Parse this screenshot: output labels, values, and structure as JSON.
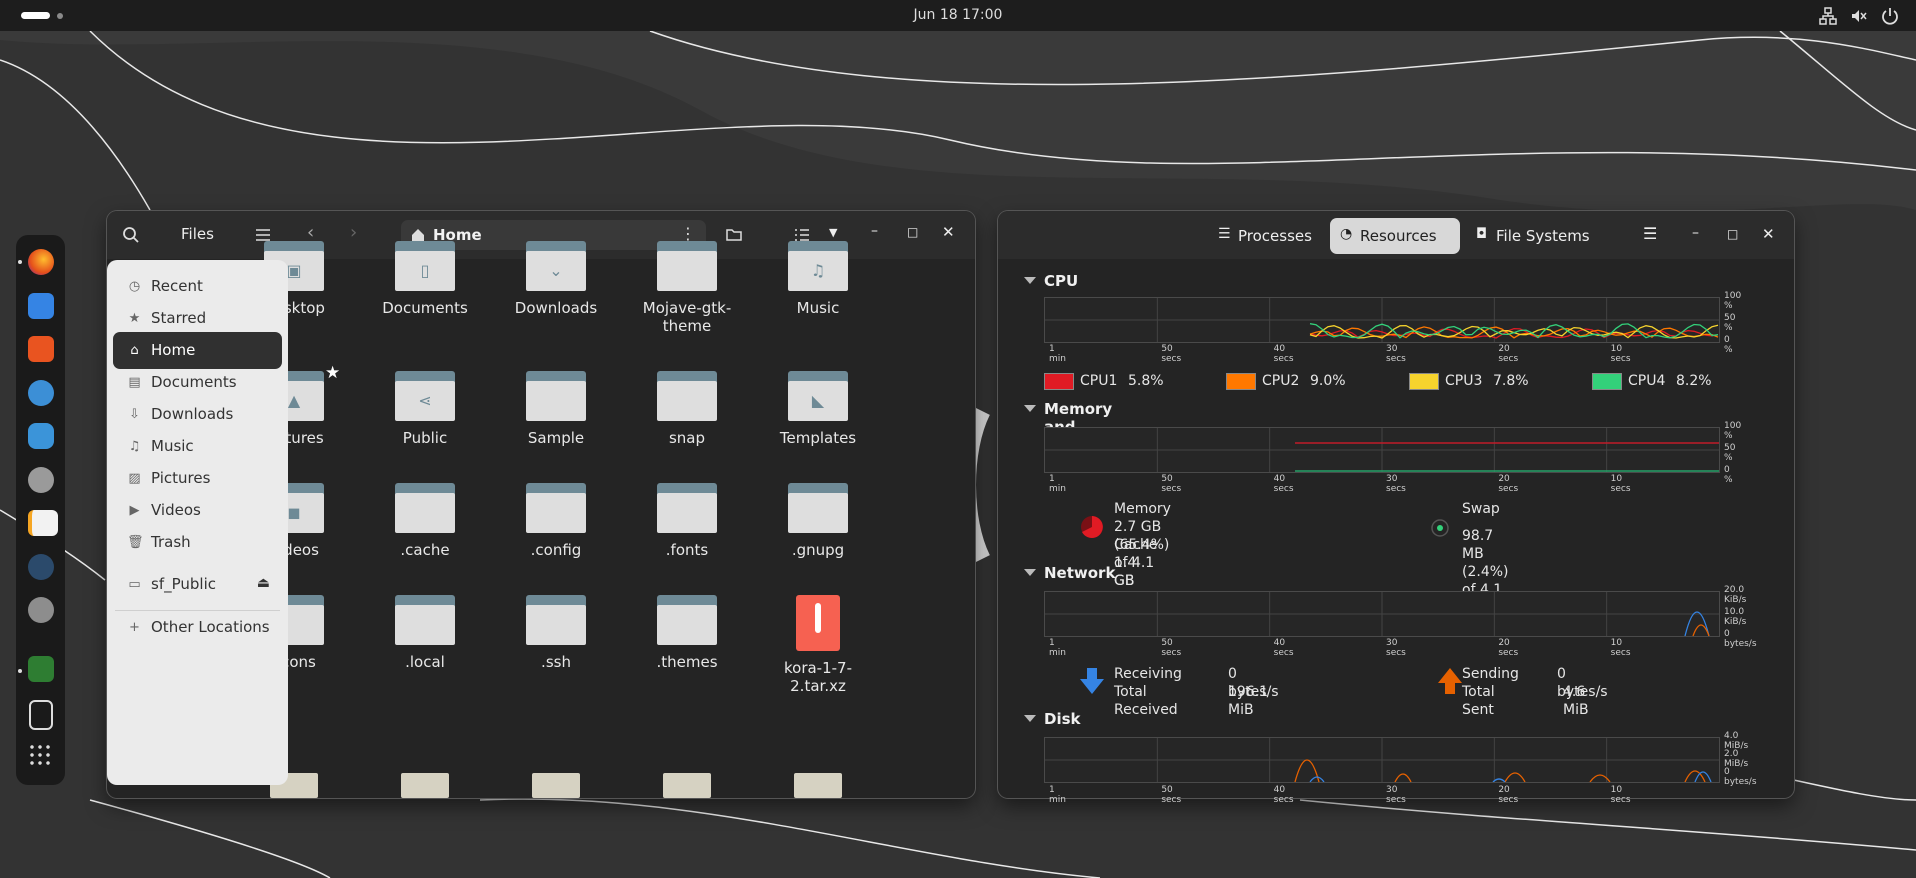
{
  "topbar": {
    "clock": "Jun 18  17:00"
  },
  "dock": {
    "items": [
      "firefox-icon",
      "files-icon",
      "app-center-icon",
      "help-icon",
      "extensions-icon",
      "settings-icon",
      "text-editor-icon",
      "terminal-icon",
      "system-settings-icon",
      "system-monitor-icon",
      "trash-icon",
      "app-grid-icon"
    ]
  },
  "files": {
    "header": {
      "title": "Files",
      "location": "Home"
    },
    "sidebar": [
      {
        "label": "Recent",
        "icon": "clock-icon"
      },
      {
        "label": "Starred",
        "icon": "star-icon"
      },
      {
        "label": "Home",
        "icon": "home-icon"
      },
      {
        "label": "Documents",
        "icon": "document-icon"
      },
      {
        "label": "Downloads",
        "icon": "download-icon"
      },
      {
        "label": "Music",
        "icon": "music-icon"
      },
      {
        "label": "Pictures",
        "icon": "picture-icon"
      },
      {
        "label": "Videos",
        "icon": "video-icon"
      },
      {
        "label": "Trash",
        "icon": "trash-icon"
      },
      {
        "label": "sf_Public",
        "icon": "drive-icon"
      },
      {
        "label": "Other Locations",
        "icon": "plus-icon"
      }
    ],
    "items": [
      {
        "label": "Desktop"
      },
      {
        "label": "Documents"
      },
      {
        "label": "Downloads"
      },
      {
        "label": "Mojave-gtk-theme"
      },
      {
        "label": "Music"
      },
      {
        "label": "Pictures"
      },
      {
        "label": "Public"
      },
      {
        "label": "Sample"
      },
      {
        "label": "snap"
      },
      {
        "label": "Templates"
      },
      {
        "label": "Videos"
      },
      {
        "label": ".cache"
      },
      {
        "label": ".config"
      },
      {
        "label": ".fonts"
      },
      {
        "label": ".gnupg"
      },
      {
        "label": ".icons"
      },
      {
        "label": ".local"
      },
      {
        "label": ".ssh"
      },
      {
        "label": ".themes"
      },
      {
        "label": "kora-1-7-2.tar.xz"
      }
    ]
  },
  "monitor": {
    "tabs": [
      "Processes",
      "Resources",
      "File Systems"
    ],
    "cpu": {
      "title": "CPU",
      "yticks": [
        "100 %",
        "50 %",
        "0 %"
      ],
      "legend": [
        {
          "name": "CPU1",
          "value": "5.8%",
          "color": "#e01b24"
        },
        {
          "name": "CPU2",
          "value": "9.0%",
          "color": "#ff7800"
        },
        {
          "name": "CPU3",
          "value": "7.8%",
          "color": "#f6d32d"
        },
        {
          "name": "CPU4",
          "value": "8.2%",
          "color": "#33d17a"
        }
      ]
    },
    "memory": {
      "title": "Memory and Swap",
      "yticks": [
        "100 %",
        "50 %",
        "0 %"
      ],
      "mem_label": "Memory",
      "mem_used": "2.7 GB (65.4%) of 4.1 GB",
      "mem_cache": "Cache 1.4 GB",
      "swap_label": "Swap",
      "swap_used": "98.7 MB (2.4%) of 4.1 GB"
    },
    "network": {
      "title": "Network",
      "yticks": [
        "20.0 KiB/s",
        "10.0 KiB/s",
        "0 bytes/s"
      ],
      "recv_label": "Receiving",
      "recv_rate": "0 bytes/s",
      "recv_total_label": "Total Received",
      "recv_total": "196.1 MiB",
      "send_label": "Sending",
      "send_rate": "0 bytes/s",
      "send_total_label": "Total Sent",
      "send_total": "4.6 MiB"
    },
    "disk": {
      "title": "Disk",
      "yticks": [
        "4.0 MiB/s",
        "2.0 MiB/s",
        "0 bytes/s"
      ]
    },
    "xticks": [
      "1 min",
      "50 secs",
      "40 secs",
      "30 secs",
      "20 secs",
      "10 secs"
    ]
  }
}
